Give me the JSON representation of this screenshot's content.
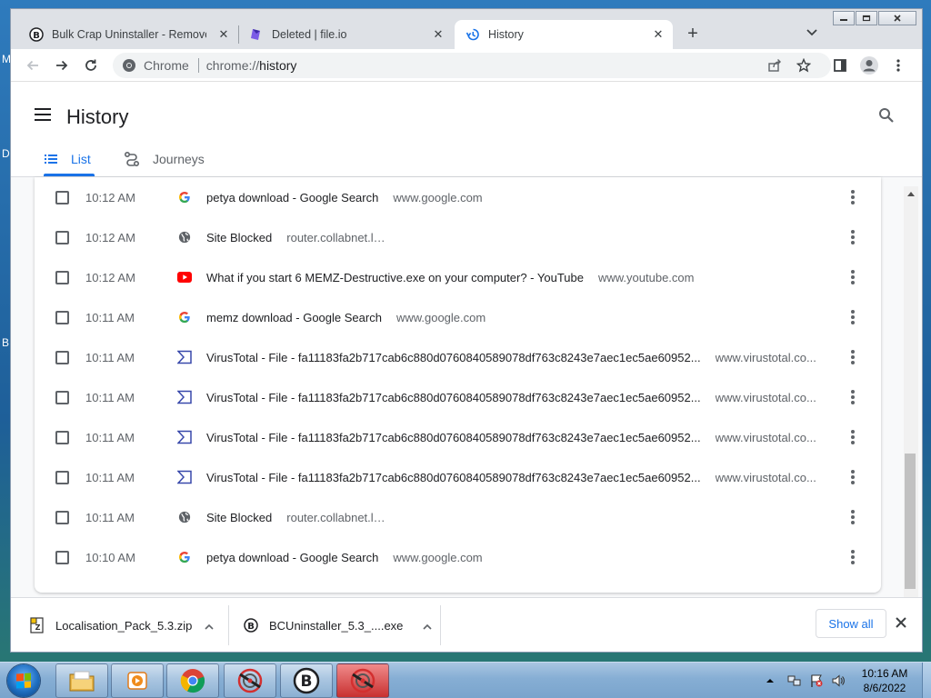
{
  "desktop": {
    "edge_letters": [
      "M",
      "D",
      "B"
    ]
  },
  "tabs": [
    {
      "title": "Bulk Crap Uninstaller - Remove la",
      "icon": "bcu-icon",
      "active": false
    },
    {
      "title": "Deleted | file.io",
      "icon": "fileio-icon",
      "active": false
    },
    {
      "title": "History",
      "icon": "history-icon",
      "active": true
    }
  ],
  "toolbar": {
    "omnibox_chip": "Chrome",
    "url_prefix": "chrome://",
    "url_path": "history"
  },
  "history": {
    "title": "History",
    "tabs": [
      {
        "label": "List",
        "selected": true
      },
      {
        "label": "Journeys",
        "selected": false
      }
    ],
    "rows": [
      {
        "time": "10:12 AM",
        "icon": "google-icon",
        "title": "petya download - Google Search",
        "domain": "www.google.com"
      },
      {
        "time": "10:12 AM",
        "icon": "globe-icon",
        "title": "Site Blocked",
        "domain": "router.collabnet.local"
      },
      {
        "time": "10:12 AM",
        "icon": "youtube-icon",
        "title": "What if you start 6 MEMZ-Destructive.exe on your computer? - YouTube",
        "domain": "www.youtube.com"
      },
      {
        "time": "10:11 AM",
        "icon": "google-icon",
        "title": "memz download - Google Search",
        "domain": "www.google.com"
      },
      {
        "time": "10:11 AM",
        "icon": "virustotal-icon",
        "title": "VirusTotal - File - fa11183fa2b717cab6c880d0760840589078df763c8243e7aec1ec5ae60952...",
        "domain": "www.virustotal.co..."
      },
      {
        "time": "10:11 AM",
        "icon": "virustotal-icon",
        "title": "VirusTotal - File - fa11183fa2b717cab6c880d0760840589078df763c8243e7aec1ec5ae60952...",
        "domain": "www.virustotal.co..."
      },
      {
        "time": "10:11 AM",
        "icon": "virustotal-icon",
        "title": "VirusTotal - File - fa11183fa2b717cab6c880d0760840589078df763c8243e7aec1ec5ae60952...",
        "domain": "www.virustotal.co..."
      },
      {
        "time": "10:11 AM",
        "icon": "virustotal-icon",
        "title": "VirusTotal - File - fa11183fa2b717cab6c880d0760840589078df763c8243e7aec1ec5ae60952...",
        "domain": "www.virustotal.co..."
      },
      {
        "time": "10:11 AM",
        "icon": "globe-icon",
        "title": "Site Blocked",
        "domain": "router.collabnet.local"
      },
      {
        "time": "10:10 AM",
        "icon": "google-icon",
        "title": "petya download - Google Search",
        "domain": "www.google.com"
      }
    ]
  },
  "downloads": {
    "items": [
      {
        "name": "Localisation_Pack_5.3.zip",
        "icon": "zip-icon"
      },
      {
        "name": "BCUninstaller_5.3_....exe",
        "icon": "bcu-icon"
      }
    ],
    "show_all_label": "Show all"
  },
  "taskbar": {
    "items": [
      {
        "name": "explorer-icon",
        "active": false
      },
      {
        "name": "media-player-icon",
        "active": false
      },
      {
        "name": "chrome-icon",
        "active": false
      },
      {
        "name": "radar-app-icon",
        "active": false
      },
      {
        "name": "bcu-icon",
        "active": false
      },
      {
        "name": "radar-app-icon",
        "active": true
      }
    ],
    "clock_time": "10:16 AM",
    "clock_date": "8/6/2022"
  },
  "colors": {
    "accent": "#1a73e8",
    "text": "#202124",
    "muted": "#5f6368",
    "youtube": "#ff0000",
    "virustotal": "#3949ab"
  }
}
